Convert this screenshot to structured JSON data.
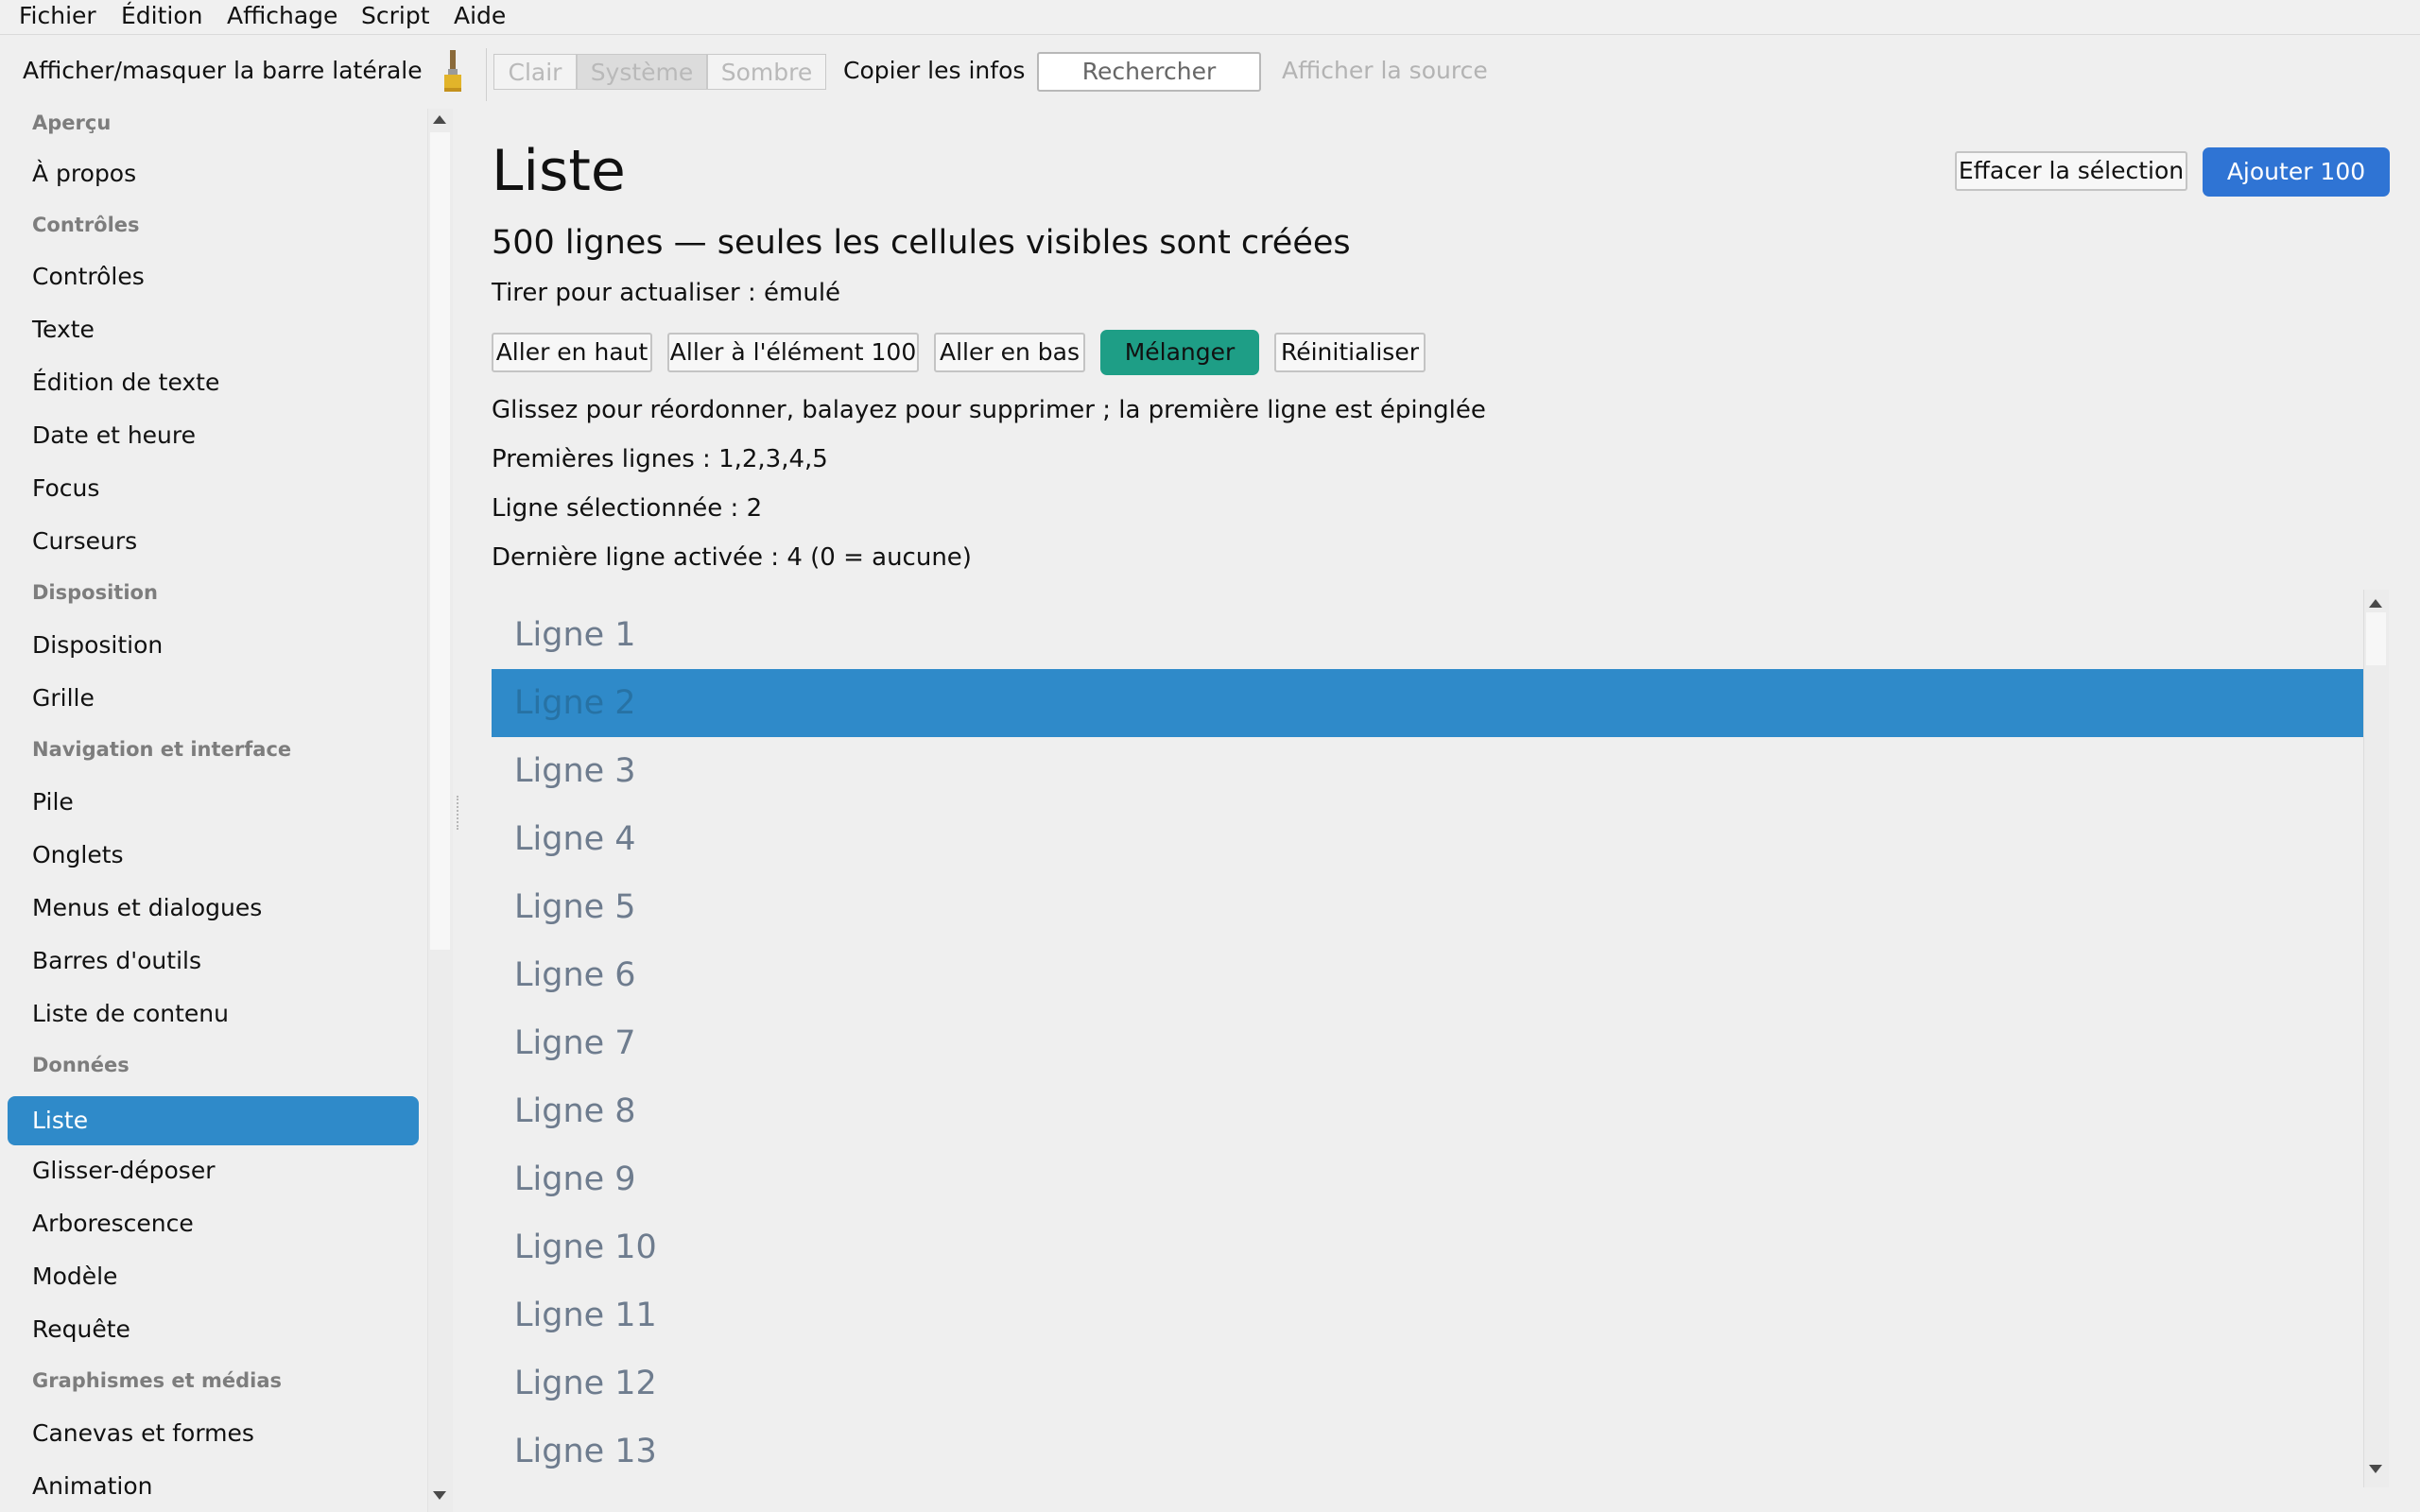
{
  "menubar": [
    "Fichier",
    "Édition",
    "Affichage",
    "Script",
    "Aide"
  ],
  "toolbar": {
    "toggle_sidebar": "Afficher/masquer la barre latérale",
    "theme_icon": "paintbrush-icon",
    "theme_light": "Clair",
    "theme_system": "Système",
    "theme_dark": "Sombre",
    "copy_info": "Copier les infos",
    "search_placeholder": "Rechercher",
    "view_source": "Afficher la source"
  },
  "sidebar": {
    "sections": [
      {
        "title": "Aperçu",
        "items": [
          "À propos"
        ]
      },
      {
        "title": "Contrôles",
        "items": [
          "Contrôles",
          "Texte",
          "Édition de texte",
          "Date et heure",
          "Focus",
          "Curseurs"
        ]
      },
      {
        "title": "Disposition",
        "items": [
          "Disposition",
          "Grille"
        ]
      },
      {
        "title": "Navigation et interface",
        "items": [
          "Pile",
          "Onglets",
          "Menus et dialogues",
          "Barres d'outils",
          "Liste de contenu"
        ]
      },
      {
        "title": "Données",
        "items": [
          "Liste",
          "Glisser-déposer",
          "Arborescence",
          "Modèle",
          "Requête"
        ]
      },
      {
        "title": "Graphismes et médias",
        "items": [
          "Canevas et formes",
          "Animation"
        ]
      }
    ],
    "active_item": "Liste"
  },
  "main": {
    "title": "Liste",
    "subtitle": "500 lignes — seules les cellules visibles sont créées",
    "pull_refresh": "Tirer pour actualiser : émulé",
    "buttons": [
      "Aller en haut",
      "Aller à l'élément 100",
      "Aller en bas",
      "Mélanger",
      "Réinitialiser"
    ],
    "clear_selection": "Effacer la sélection",
    "add_100": "Ajouter 100",
    "hint": "Glissez pour réordonner, balayez pour supprimer ; la première ligne est épinglée",
    "first_rows": "Premières lignes : 1,2,3,4,5",
    "selected_row": "Ligne sélectionnée : 2",
    "last_activated": "Dernière ligne activée : 4 (0 = aucune)",
    "rows": [
      "Ligne 1",
      "Ligne 2",
      "Ligne 3",
      "Ligne 4",
      "Ligne 5",
      "Ligne 6",
      "Ligne 7",
      "Ligne 8",
      "Ligne 9",
      "Ligne 10",
      "Ligne 11",
      "Ligne 12",
      "Ligne 13"
    ],
    "selected_index": 1
  },
  "colors": {
    "accent": "#2f8ac9",
    "primary_button": "#2f74d4",
    "shuffle_button": "#1e9e86"
  }
}
